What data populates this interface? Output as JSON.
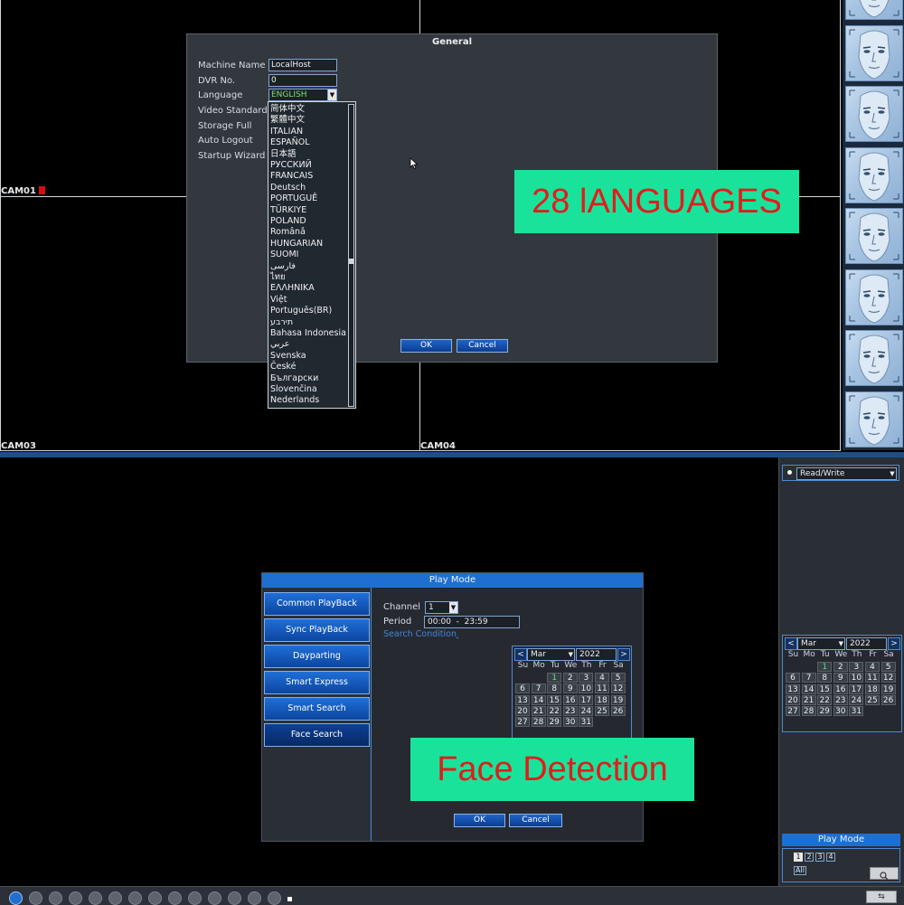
{
  "general": {
    "title": "General",
    "labels": [
      "Machine Name",
      "DVR No.",
      "Language",
      "Video Standard",
      "Storage Full",
      "Auto Logout",
      "Startup Wizard"
    ],
    "machine_name": "LocalHost",
    "dvr_no": "0",
    "language_selected": "ENGLISH",
    "ok_label": "OK",
    "cancel_label": "Cancel"
  },
  "language_options": [
    "简体中文",
    "繁體中文",
    "ITALIAN",
    "ESPAÑOL",
    "日本語",
    "РУССКИЙ",
    "FRANCAIS",
    "Deutsch",
    "PORTUGUÊ",
    "TÜRKIYE",
    "POLAND",
    "Românǎ",
    "HUNGARIAN",
    "SUOMI",
    "فارسی",
    "ไทย",
    "ΕΛΛΗΝΙΚΑ",
    "Việt",
    "Português(BR)",
    "תירבע",
    "Bahasa Indonesia",
    "عربي",
    "Svenska",
    "České",
    "Български",
    "Slovenčina",
    "Nederlands"
  ],
  "cameras": {
    "cam01": "CAM01",
    "cam03": "CAM03",
    "cam04": "CAM04"
  },
  "banners": {
    "languages": "28 lANGUAGES",
    "face": "Face Detection"
  },
  "playmode": {
    "title": "Play Mode",
    "sidebar": [
      "Common PlayBack",
      "Sync PlayBack",
      "Dayparting",
      "Smart Express",
      "Smart Search",
      "Face Search"
    ],
    "channel_label": "Channel",
    "channel_value": "1",
    "period_label": "Period",
    "period_value": "00:00  -  23:59",
    "search_condition": "Search Condition",
    "ok_label": "OK",
    "cancel_label": "Cancel"
  },
  "calendar": {
    "month": "Mar",
    "year": "2022",
    "weekdays": [
      "Su",
      "Mo",
      "Tu",
      "We",
      "Th",
      "Fr",
      "Sa"
    ],
    "days": [
      "1",
      "2",
      "3",
      "4",
      "5",
      "6",
      "7",
      "8",
      "9",
      "10",
      "11",
      "12",
      "13",
      "14",
      "15",
      "16",
      "17",
      "18",
      "19",
      "20",
      "21",
      "22",
      "23",
      "24",
      "25",
      "26",
      "27",
      "28",
      "29",
      "30",
      "31"
    ],
    "first_weekday": 2,
    "highlight_day": "1",
    "prev": "<",
    "next": ">"
  },
  "right_panel": {
    "mode": "Read/Write",
    "play_mode_label": "Play Mode",
    "channels": [
      "1",
      "2",
      "3",
      "4"
    ],
    "all_label": "All"
  },
  "colors": {
    "banner_bg": "#19e39a",
    "banner_text": "#e21c1c",
    "accent_blue": "#1f6fd1"
  }
}
